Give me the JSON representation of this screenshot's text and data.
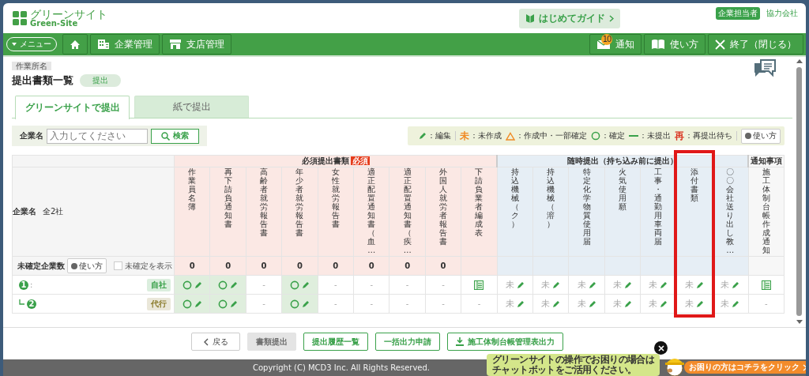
{
  "header": {
    "logo": {
      "title": "グリーンサイト",
      "subtitle": "Green-Site"
    },
    "guide_button": "はじめてガイド",
    "role_badge": "企業担当者",
    "company_type": "協力会社"
  },
  "nav": {
    "menu_button": "メニュー",
    "left_items": [
      {
        "kind": "home"
      },
      {
        "kind": "building",
        "label": "企業管理"
      },
      {
        "kind": "store",
        "label": "支店管理"
      }
    ],
    "right_items": [
      {
        "kind": "mail",
        "label": "通知",
        "badge": "10"
      },
      {
        "kind": "book",
        "label": "使い方"
      },
      {
        "kind": "close",
        "label": "終了（閉じる）"
      }
    ]
  },
  "breadcrumb": "作業所名",
  "page": {
    "title": "提出書類一覧",
    "status_badge": "提出"
  },
  "tabs": [
    {
      "label": "グリーンサイトで提出",
      "selected": true
    },
    {
      "label": "紙で提出",
      "selected": false
    }
  ],
  "search": {
    "label": "企業名",
    "placeholder": "入力してください",
    "button": "検索"
  },
  "legend": {
    "items": [
      {
        "kind": "pencil",
        "label": "：編集"
      },
      {
        "kind": "char",
        "symbol": "未",
        "color": "#f08a24",
        "label": "：未作成"
      },
      {
        "kind": "triangle",
        "label": "：作成中・一部確定"
      },
      {
        "kind": "circle",
        "label": "：確定"
      },
      {
        "kind": "dash",
        "label": "：未提出"
      },
      {
        "kind": "char",
        "symbol": "再",
        "color": "#d9301c",
        "label": "：再提出待ち"
      }
    ],
    "help_button": "使い方"
  },
  "table": {
    "company_header": {
      "label": "企業名",
      "count": "全2社"
    },
    "unconfirmed": {
      "label": "未確定企業数",
      "help_button": "使い方",
      "checkbox_label": "未確定を表示",
      "checked": false
    },
    "groups": [
      {
        "kind": "required",
        "label": "必須提出書類",
        "badge": "必須",
        "columns": [
          {
            "label": "作業員名簿",
            "count": "0"
          },
          {
            "label": "再下請負通知書",
            "count": "0"
          },
          {
            "label": "高齢者就労報告書",
            "count": "0"
          },
          {
            "label": "年少者就労報告書",
            "count": "0"
          },
          {
            "label": "女性就労報告書",
            "count": "0"
          },
          {
            "label": "適正配置通知書（血…",
            "count": "0"
          },
          {
            "label": "適正配置通知書（疾…",
            "count": "0"
          },
          {
            "label": "外国人就労者報告書",
            "count": "0"
          },
          {
            "label": "下請負業者編成表"
          }
        ]
      },
      {
        "kind": "optional",
        "label": "随時提出（持ち込み前に提出）",
        "columns": [
          {
            "label": "持込機械（ク）"
          },
          {
            "label": "持込機械（溶）"
          },
          {
            "label": "特定化学物質使用届"
          },
          {
            "label": "火気使用願"
          },
          {
            "label": "工事・通勤用車両届"
          },
          {
            "label": "添付書類",
            "highlighted": true
          },
          {
            "label": "〇〇会社送り出し教…"
          }
        ]
      },
      {
        "kind": "notice",
        "label": "通知事項",
        "columns": [
          {
            "label": "施工体制台帳作成通知"
          }
        ]
      }
    ],
    "rows": [
      {
        "number": "1",
        "name": ":",
        "tag": "自社",
        "color": "#3aa14a",
        "cells": [
          {
            "kind": "done"
          },
          {
            "kind": "done"
          },
          {
            "kind": "none",
            "text": "-"
          },
          {
            "kind": "done"
          },
          {
            "kind": "none",
            "text": "-"
          },
          {
            "kind": "none",
            "text": "-"
          },
          {
            "kind": "none",
            "text": "-"
          },
          {
            "kind": "none",
            "text": "-"
          },
          {
            "kind": "ledger"
          },
          {
            "kind": "uncreated",
            "text": "未"
          },
          {
            "kind": "uncreated",
            "text": "未"
          },
          {
            "kind": "uncreated",
            "text": "未"
          },
          {
            "kind": "uncreated",
            "text": "未"
          },
          {
            "kind": "uncreated",
            "text": "未"
          },
          {
            "kind": "uncreated",
            "text": "未"
          },
          {
            "kind": "uncreated",
            "text": "未"
          },
          {
            "kind": "ledger"
          }
        ],
        "children": [
          {
            "number": "2",
            "tag": "代行",
            "color": "#8a7a2a",
            "cells": [
              {
                "kind": "done"
              },
              {
                "kind": "done"
              },
              {
                "kind": "none",
                "text": "-"
              },
              {
                "kind": "done"
              },
              {
                "kind": "none",
                "text": "-"
              },
              {
                "kind": "none",
                "text": "-"
              },
              {
                "kind": "none",
                "text": "-"
              },
              {
                "kind": "none",
                "text": "-"
              },
              {
                "kind": "none",
                "text": "-"
              },
              {
                "kind": "uncreated",
                "text": "未"
              },
              {
                "kind": "uncreated",
                "text": "未"
              },
              {
                "kind": "uncreated",
                "text": "未"
              },
              {
                "kind": "uncreated",
                "text": "未"
              },
              {
                "kind": "uncreated",
                "text": "未"
              },
              {
                "kind": "uncreated",
                "text": "未"
              },
              {
                "kind": "uncreated",
                "text": "未"
              },
              {
                "kind": "none",
                "text": "-"
              }
            ]
          }
        ]
      }
    ]
  },
  "footer_buttons": [
    {
      "kind": "back",
      "label": "戻る",
      "disabled": false
    },
    {
      "kind": "plain",
      "label": "書類提出",
      "disabled": true
    },
    {
      "kind": "plain",
      "label": "提出履歴一覧",
      "disabled": false
    },
    {
      "kind": "plain",
      "label": "一括出力申請",
      "disabled": false
    },
    {
      "kind": "download",
      "label": "施工体制台帳管理表出力",
      "disabled": false
    }
  ],
  "copyright": "Copyright (C) MCD3 Inc. All Rights Reserved.",
  "chatbot": {
    "message_lines": [
      "グリーンサイトの操作でお困りの場合は",
      "チャットボットをご活用ください。"
    ],
    "button": "お困りの方はコチラをクリック"
  }
}
